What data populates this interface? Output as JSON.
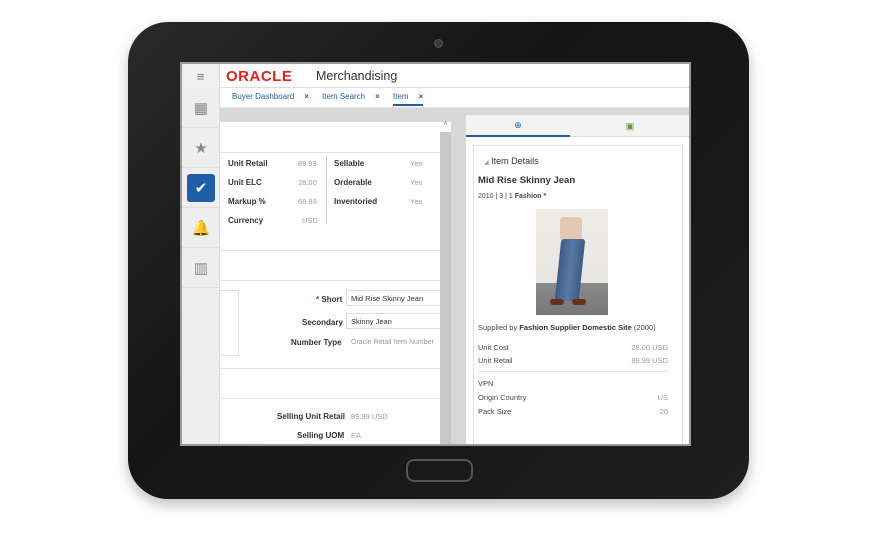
{
  "header": {
    "logo": "ORACLE",
    "app_name": "Merchandising",
    "menu_icon": "≡"
  },
  "sidebar": {
    "items": [
      {
        "name": "apps",
        "icon": "▦"
      },
      {
        "name": "favorites",
        "icon": "★"
      },
      {
        "name": "tasks",
        "icon": "✔"
      },
      {
        "name": "notifications",
        "icon": "🔔"
      },
      {
        "name": "reports",
        "icon": "▥"
      }
    ]
  },
  "tabs": [
    {
      "label": "Buyer Dashboard",
      "close": "×"
    },
    {
      "label": "Item Search",
      "close": "×"
    },
    {
      "label": "Item",
      "close": "×"
    }
  ],
  "summary": {
    "left": [
      {
        "label": "Unit Retail",
        "value": "89.99"
      },
      {
        "label": "Unit ELC",
        "value": "28.00"
      },
      {
        "label": "Markup %",
        "value": "68.89"
      },
      {
        "label": "Currency",
        "value": "USD"
      }
    ],
    "right": [
      {
        "label": "Sellable",
        "value": "Yes"
      },
      {
        "label": "Orderable",
        "value": "Yes"
      },
      {
        "label": "Inventoried",
        "value": "Yes"
      }
    ]
  },
  "description": {
    "required_mark": "*",
    "short_label": "Short",
    "short_value": "Mid Rise Skinny Jean",
    "secondary_label": "Secondary",
    "secondary_value": "Skinny Jean",
    "number_type_label": "Number Type",
    "number_type_value": "Oracle Retail Item Number"
  },
  "selling": {
    "unit_retail_label": "Selling Unit Retail",
    "unit_retail_value": "89.99 USD",
    "uom_label": "Selling UOM",
    "uom_value": "EA"
  },
  "details": {
    "section_title": "Item Details",
    "item_name": "Mid Rise Skinny Jean",
    "hierarchy": "2010 | 3 | 1",
    "hierarchy_name": "Fashion *",
    "supplied_by_label": "Supplied by",
    "supplier": "Fashion Supplier Domestic Site",
    "supplier_id": "(2000)",
    "unit_cost_label": "Unit Cost",
    "unit_cost": "28.00 USD",
    "unit_retail_label": "Unit Retail",
    "unit_retail": "89.99 USD",
    "vpn_label": "VPN",
    "origin_label": "Origin Country",
    "origin": "US",
    "pack_label": "Pack Size",
    "pack": "20"
  }
}
